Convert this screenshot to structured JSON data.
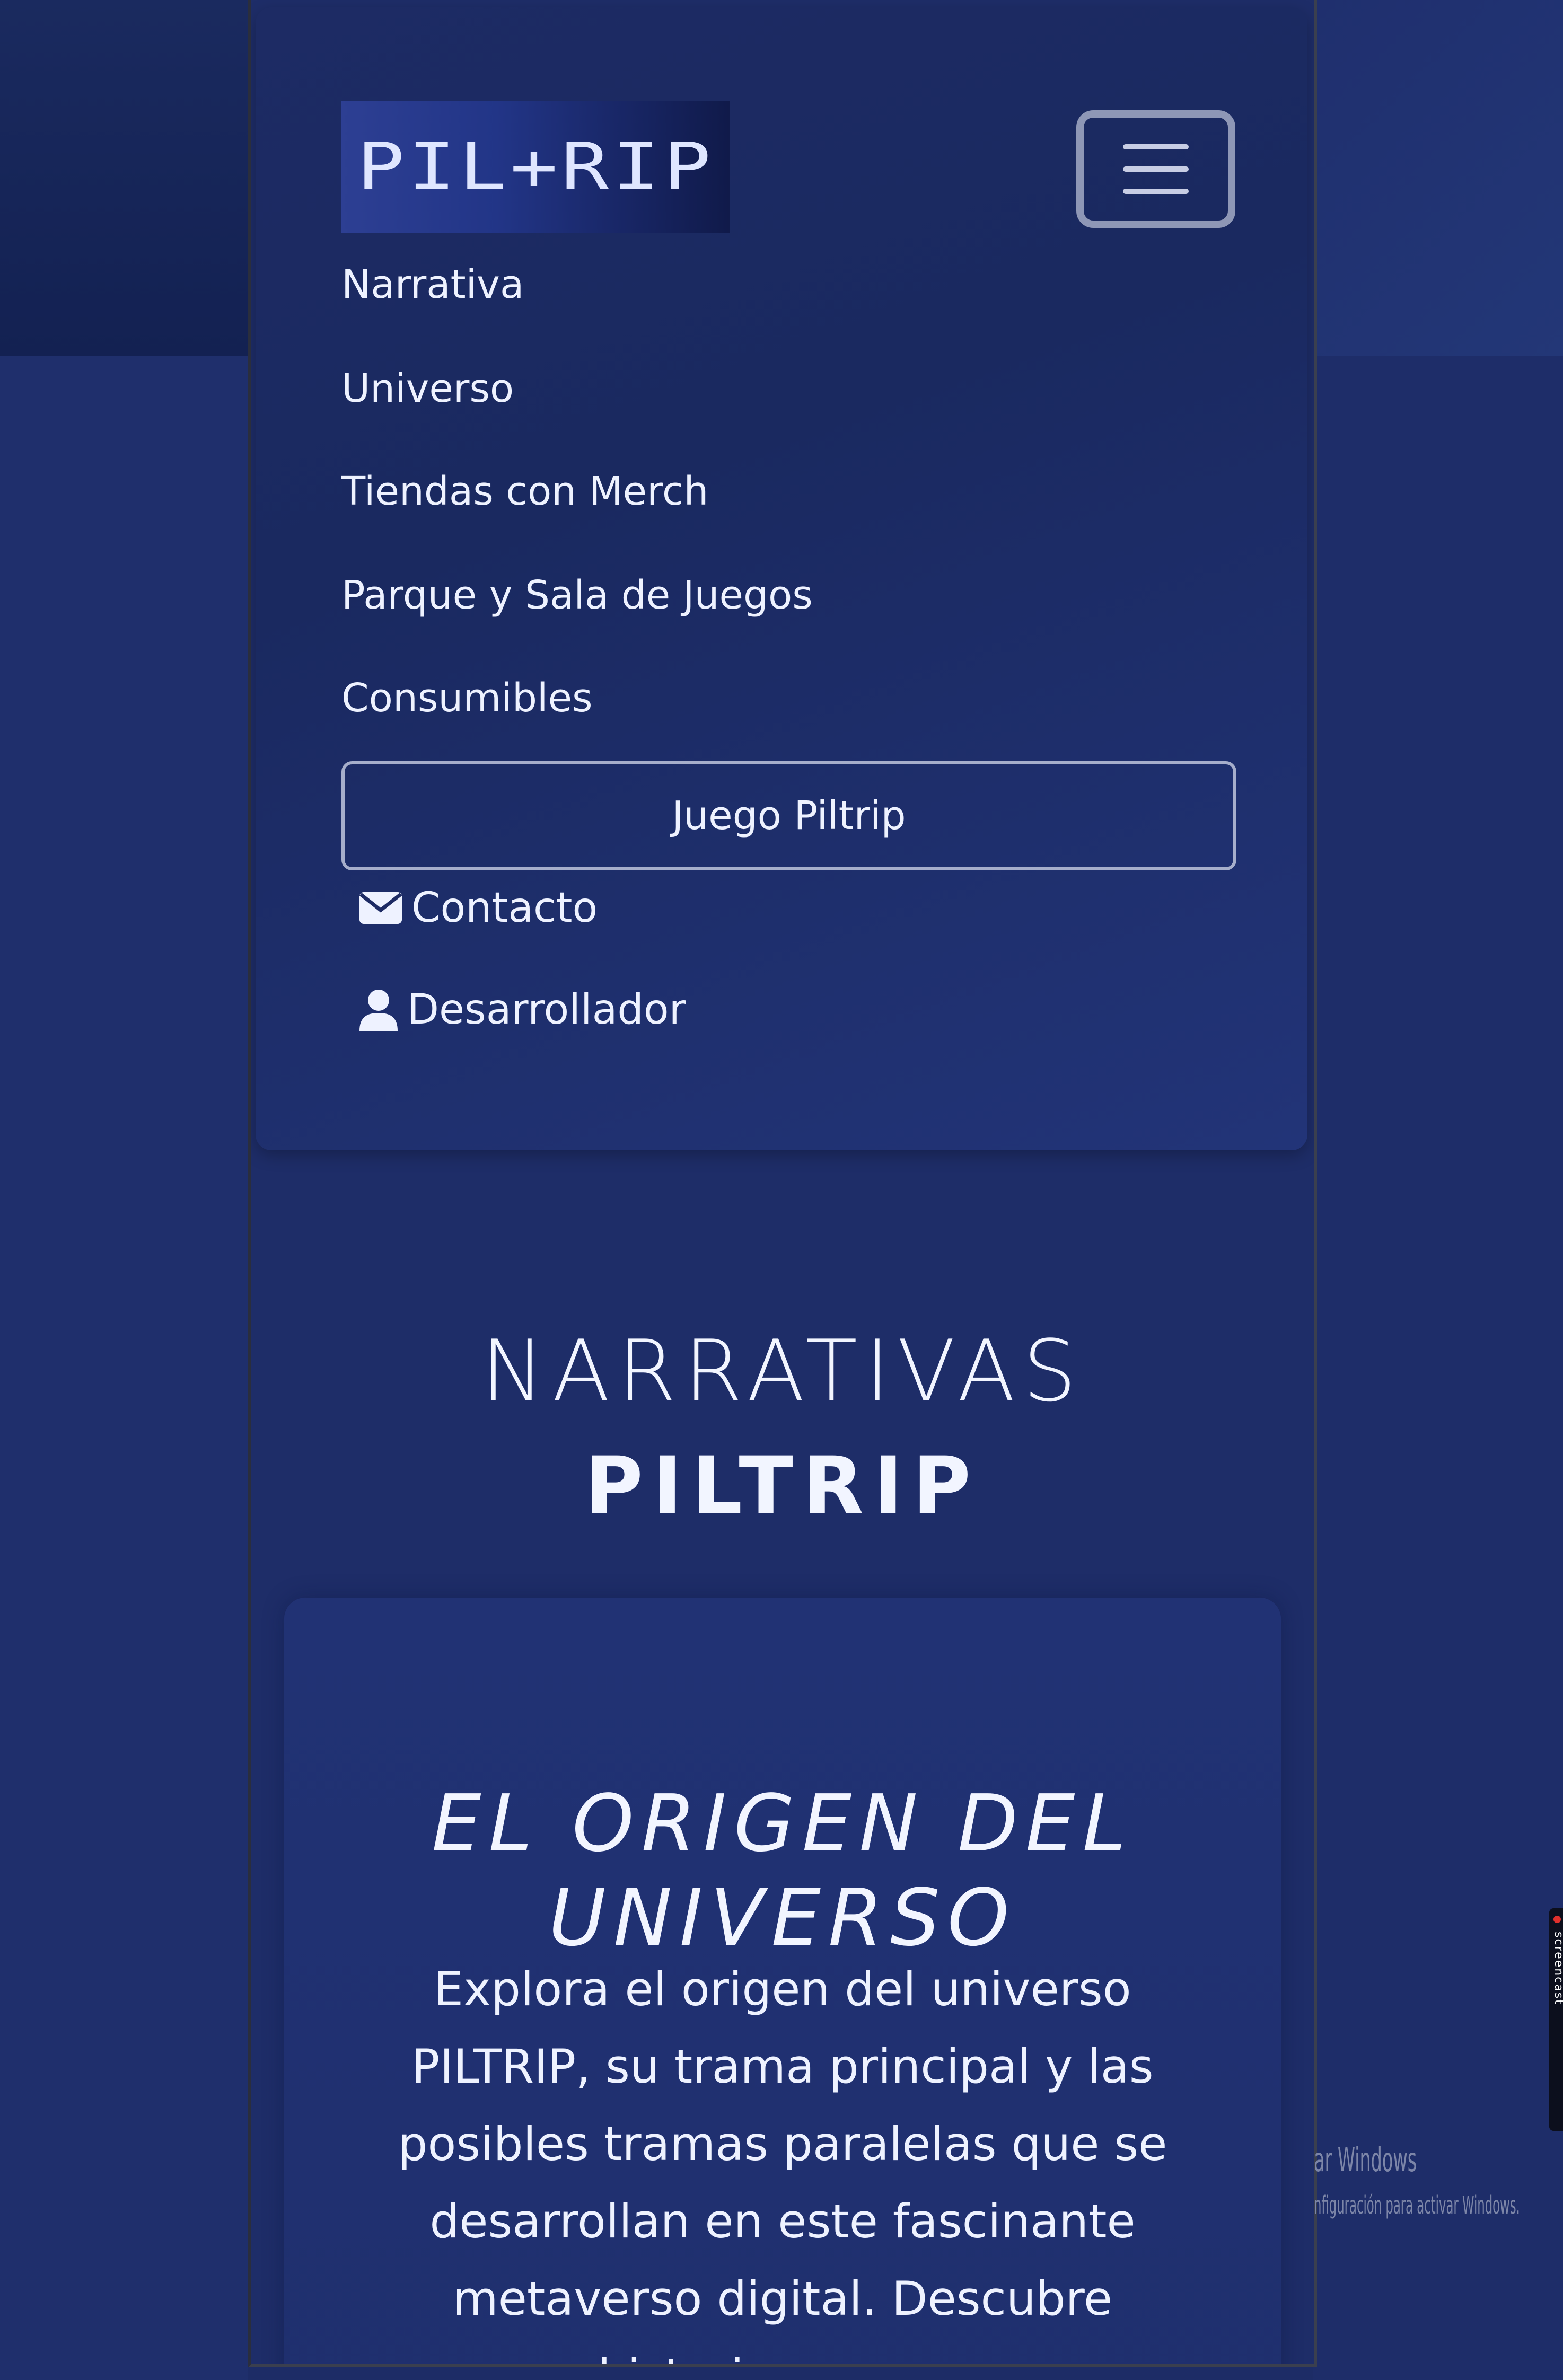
{
  "brand": {
    "logo_text": "PIL+RIP"
  },
  "nav": {
    "items": [
      {
        "label": "Narrativa"
      },
      {
        "label": "Universo"
      },
      {
        "label": "Tiendas con Merch"
      },
      {
        "label": "Parque y Sala de Juegos"
      },
      {
        "label": "Consumibles"
      }
    ],
    "game_button_label": "Juego Piltrip",
    "contact_label": "Contacto",
    "developer_label": "Desarrollador",
    "icons": {
      "toggler": "hamburger-menu-icon",
      "contact": "envelope-icon",
      "developer": "user-icon"
    }
  },
  "hero": {
    "title": "NARRATIVAS",
    "subtitle": "PILTRIP"
  },
  "card": {
    "title": "EL ORIGEN DEL UNIVERSO",
    "body": "Explora el origen del universo PILTRIP, su trama principal y las posibles tramas paralelas que se desarrollan en este fascinante metaverso digital. Descubre historias que se"
  },
  "system": {
    "watermark_line1": "ar Windows",
    "watermark_line2": "nfiguración para activar Windows.",
    "screencast_label": "screencast"
  },
  "colors": {
    "background": "#1d2c66",
    "navbar": "#1d2b64",
    "text": "#eef2ff",
    "border": "#a6aecb"
  }
}
